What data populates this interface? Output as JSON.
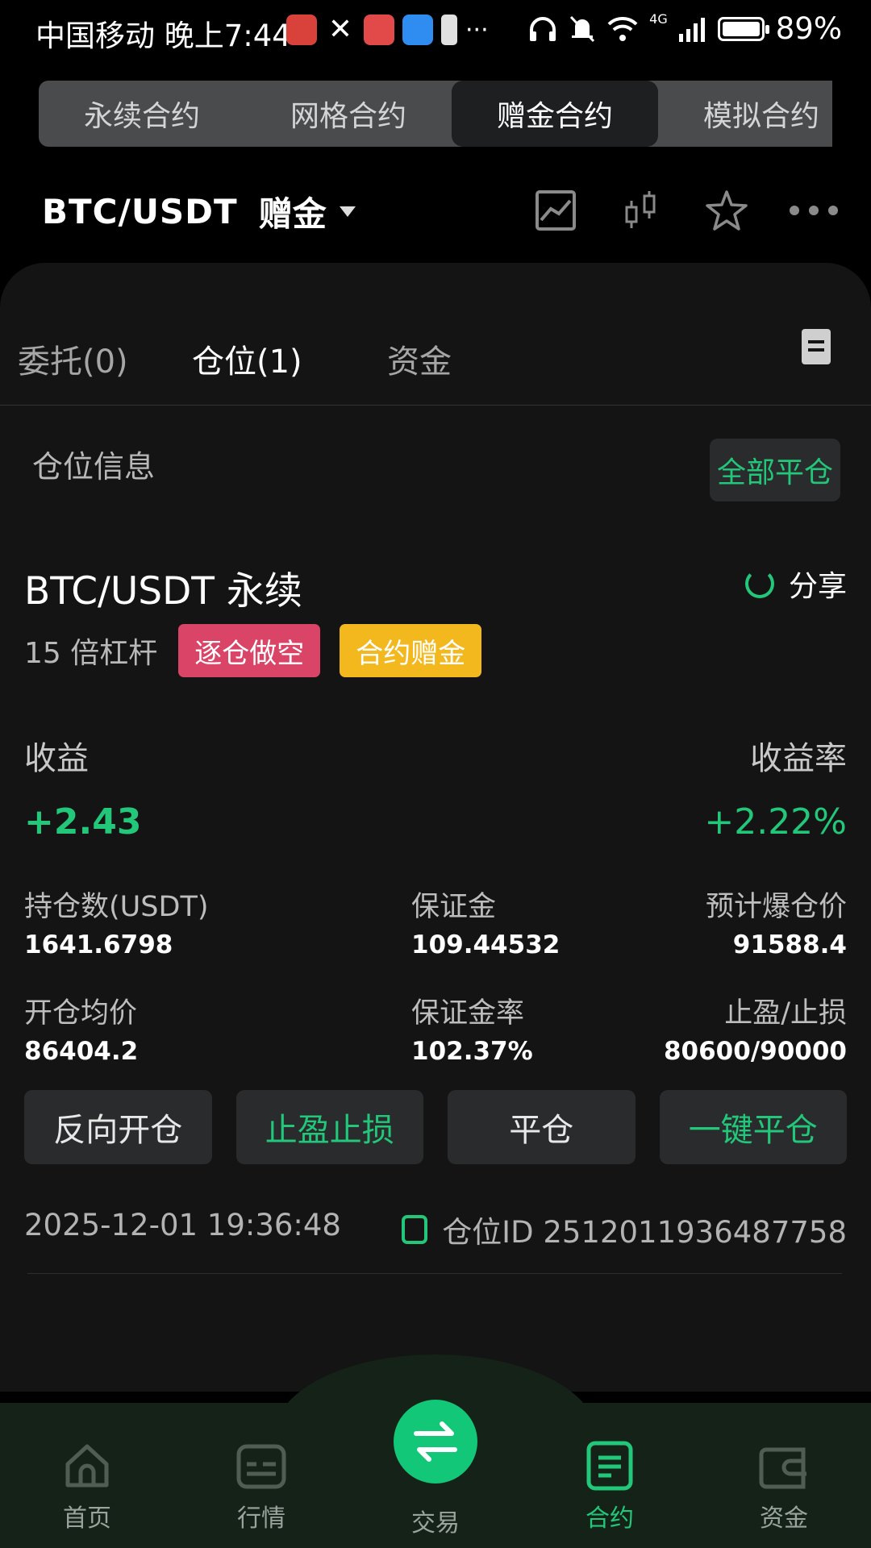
{
  "status_bar": {
    "left_text": "中国移动 晚上7:44",
    "more": "···",
    "network": "4G",
    "battery": "89%"
  },
  "contract_tabs": [
    {
      "label": "永续合约"
    },
    {
      "label": "网格合约"
    },
    {
      "label": "赠金合约"
    },
    {
      "label": "模拟合约"
    }
  ],
  "header": {
    "pair": "BTC/USDT",
    "pair_suffix": "赠金",
    "icons": [
      "chart-icon",
      "candlestick-icon",
      "star-icon",
      "more-icon"
    ]
  },
  "sub_tabs": [
    {
      "label": "委托(0)"
    },
    {
      "label": "仓位(1)"
    },
    {
      "label": "资金"
    }
  ],
  "position": {
    "section_title": "仓位信息",
    "close_all": "全部平仓",
    "name": "BTC/USDT 永续",
    "share": "分享",
    "leverage": "15 倍杠杆",
    "tag_side": "逐仓做空",
    "tag_bonus": "合约赠金",
    "pnl_label": "收益",
    "pnl_value": "+2.43",
    "roe_label": "收益率",
    "roe_value": "+2.22%",
    "size_label": "持仓数(USDT)",
    "size_value": "1641.6798",
    "margin_label": "保证金",
    "margin_value": "109.44532",
    "liq_label": "预计爆仓价",
    "liq_value": "91588.4",
    "entry_label": "开仓均价",
    "entry_value": "86404.2",
    "margin_ratio_label": "保证金率",
    "margin_ratio_value": "102.37%",
    "tpsl_label": "止盈/止损",
    "tpsl_value": "80600/90000",
    "actions": {
      "reverse": "反向开仓",
      "tpsl": "止盈止损",
      "close": "平仓",
      "quick_close": "一键平仓"
    },
    "time": "2025-12-01 19:36:48",
    "id_text": "仓位ID 2512011936487758"
  },
  "bottom_nav": {
    "home": "首页",
    "market": "行情",
    "trade": "交易",
    "contract": "合约",
    "assets": "资金"
  },
  "colors": {
    "accent_green": "#22c77a",
    "short_tag": "#d94467",
    "bonus_tag": "#f2b81e",
    "background": "#000000",
    "panel": "#141414"
  }
}
